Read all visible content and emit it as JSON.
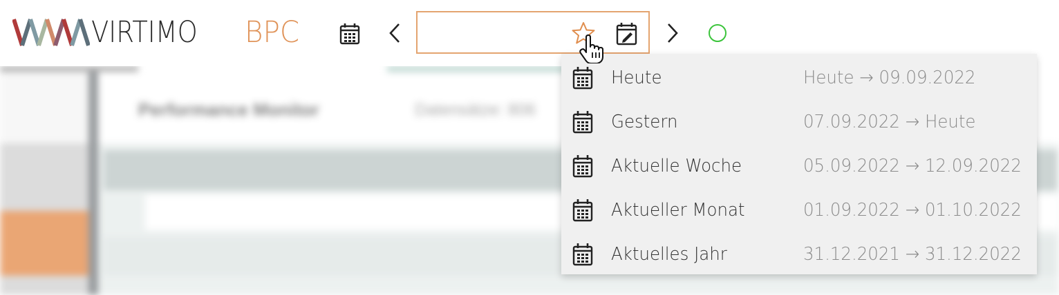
{
  "brand": {
    "name": "VIRTIMO",
    "product": "BPC",
    "logo_colors": [
      "#b03a3a",
      "#7f9aa3",
      "#d08a6a",
      "#a8b7a0",
      "#8e5c6e",
      "#5d6f7a"
    ],
    "accent": "#e0945a"
  },
  "toolbar": {
    "calendar_icon": "calendar-icon",
    "prev_icon": "chevron-left-icon",
    "next_icon": "chevron-right-icon",
    "favorite_icon": "star-icon",
    "edit_calendar_icon": "calendar-edit-icon",
    "status_icon": "status-circle-icon",
    "status_color": "#3bc43b",
    "date_range_value": "",
    "date_range_border_color": "#e4a46f"
  },
  "background": {
    "title": "Performance Monitor",
    "subtitle": "Datensätze: 806"
  },
  "favorites_menu": {
    "items": [
      {
        "label": "Heute",
        "range": "Heute → 09.09.2022",
        "icon": "calendar-icon"
      },
      {
        "label": "Gestern",
        "range": "07.09.2022 → Heute",
        "icon": "calendar-icon"
      },
      {
        "label": "Aktuelle Woche",
        "range": "05.09.2022 → 12.09.2022",
        "icon": "calendar-icon"
      },
      {
        "label": "Aktueller Monat",
        "range": "01.09.2022 → 01.10.2022",
        "icon": "calendar-icon"
      },
      {
        "label": "Aktuelles Jahr",
        "range": "31.12.2021 → 31.12.2022",
        "icon": "calendar-icon"
      }
    ]
  }
}
